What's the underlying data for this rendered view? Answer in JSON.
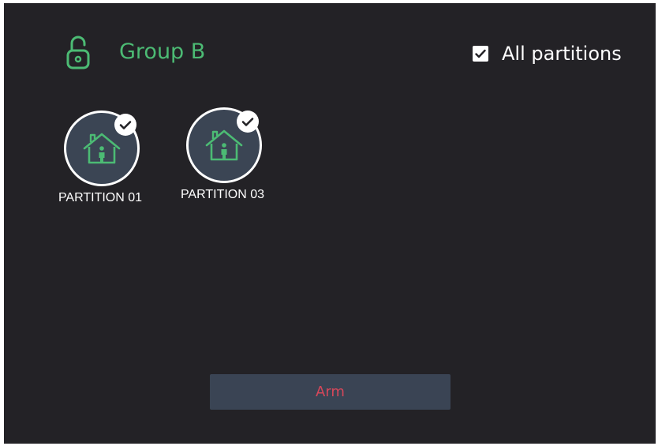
{
  "header": {
    "lock_icon": "unlocked-padlock-icon",
    "group_name": "Group B"
  },
  "all_partitions": {
    "label": "All partitions",
    "checked": true
  },
  "partitions": [
    {
      "label": "PARTITION 01",
      "icon": "house-person-icon",
      "selected": true
    },
    {
      "label": "PARTITION 03",
      "icon": "house-person-icon",
      "selected": true
    }
  ],
  "actions": {
    "arm_label": "Arm"
  },
  "colors": {
    "background": "#232226",
    "accent_green": "#4cbb74",
    "partition_fill": "#3b4554",
    "button_fill": "#3a4454",
    "button_text": "#d6475a"
  }
}
